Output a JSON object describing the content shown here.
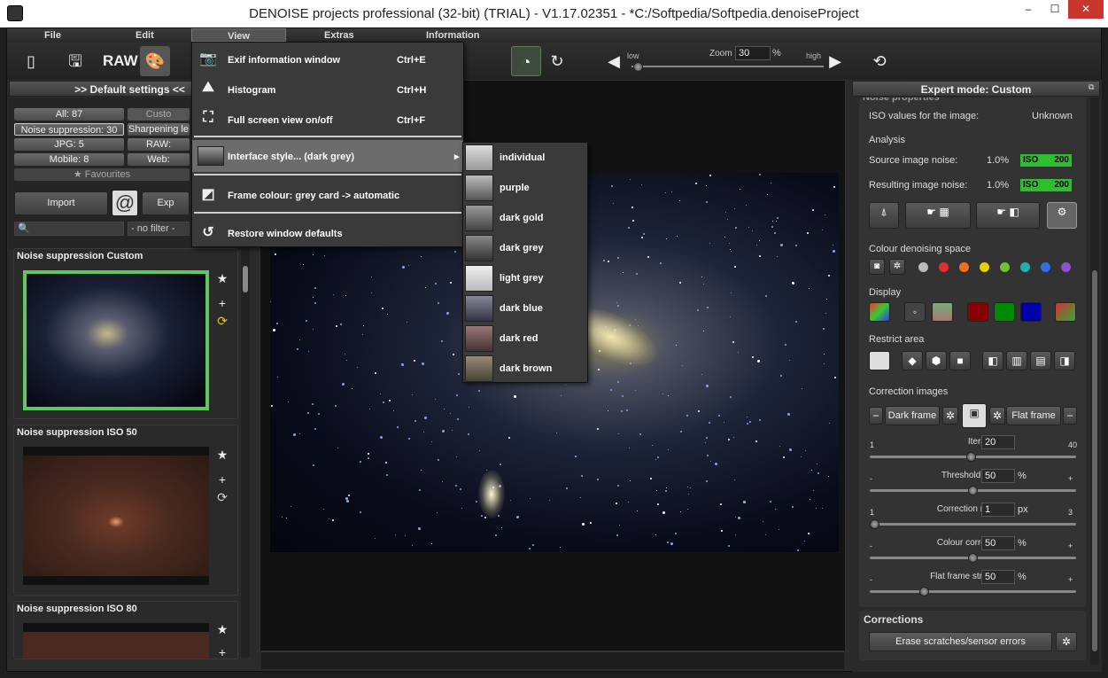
{
  "window": {
    "title": "DENOISE projects professional (32-bit) (TRIAL) - V1.17.02351 - *C:/Softpedia/Softpedia.denoiseProject",
    "minimize": "–",
    "maximize": "☐",
    "close": "✕"
  },
  "menubar": [
    "File",
    "Edit",
    "View",
    "Extras",
    "Information"
  ],
  "toolbar": {
    "raw_label": "RAW",
    "low_label": "low",
    "zoom_label": "Zoom",
    "zoom_value": "30",
    "zoom_unit": "%",
    "high_label": "high"
  },
  "left": {
    "header": ">> Default settings <<",
    "filters": {
      "all": "All: 87",
      "custom": "Custo",
      "noise": "Noise suppression: 30",
      "sharpening": "Sharpening le",
      "jpg": "JPG: 5",
      "raw": "RAW:",
      "mobile": "Mobile: 8",
      "web": "Web:",
      "favourites": "Favourites"
    },
    "import_label": "Import",
    "export_label": "Exp",
    "search_placeholder": "",
    "filter_select": "- no filter -",
    "presets": [
      "Noise suppression Custom",
      "Noise suppression ISO 50",
      "Noise suppression ISO 80"
    ]
  },
  "view_menu": {
    "items": [
      {
        "label": "Exif information window",
        "shortcut": "Ctrl+E"
      },
      {
        "label": "Histogram",
        "shortcut": "Ctrl+H"
      },
      {
        "label": "Full screen view on/off",
        "shortcut": "Ctrl+F"
      },
      {
        "label": "Interface style... (dark grey)",
        "shortcut": ""
      },
      {
        "label": "Frame colour: grey card -> automatic",
        "shortcut": ""
      },
      {
        "label": "Restore window defaults",
        "shortcut": ""
      }
    ]
  },
  "style_submenu": [
    "individual",
    "purple",
    "dark gold",
    "dark grey",
    "light grey",
    "dark blue",
    "dark red",
    "dark brown"
  ],
  "right": {
    "header": "Expert mode: Custom",
    "section_title": "Noise properties",
    "iso_label": "ISO values for the image:",
    "iso_value": "Unknown",
    "analysis": "Analysis",
    "source_label": "Source image noise:",
    "source_value": "1.0%",
    "result_label": "Resulting image noise:",
    "result_value": "1.0%",
    "iso_badge": "ISO",
    "iso_badge_value": "200",
    "colour_space": "Colour denoising space",
    "display": "Display",
    "restrict": "Restrict area",
    "correction_images": "Correction images",
    "dark_frame": "Dark frame",
    "flat_frame": "Flat frame",
    "sliders": [
      {
        "label": "Iterations",
        "value": "20",
        "unit": "",
        "min": "1",
        "max": "40",
        "level": 0.49
      },
      {
        "label": "Threshold value",
        "value": "50",
        "unit": "%",
        "min": "-",
        "max": "+",
        "level": 0.5
      },
      {
        "label": "Correction radius",
        "value": "1",
        "unit": "px",
        "min": "1",
        "max": "3",
        "level": 0.0
      },
      {
        "label": "Colour correction",
        "value": "50",
        "unit": "%",
        "min": "-",
        "max": "+",
        "level": 0.5
      },
      {
        "label": "Flat frame strength",
        "value": "50",
        "unit": "%",
        "min": "-",
        "max": "+",
        "level": 0.25
      }
    ],
    "corrections_title": "Corrections",
    "erase_label": "Erase scratches/sensor errors"
  },
  "colors": {
    "accent_green": "#2dbf2d",
    "selected_border": "#5ec85e",
    "dot_colors": [
      "#bbbbbb",
      "#e03030",
      "#f07020",
      "#e8d000",
      "#70c030",
      "#20b0b0",
      "#3070e0",
      "#9050d0"
    ]
  }
}
